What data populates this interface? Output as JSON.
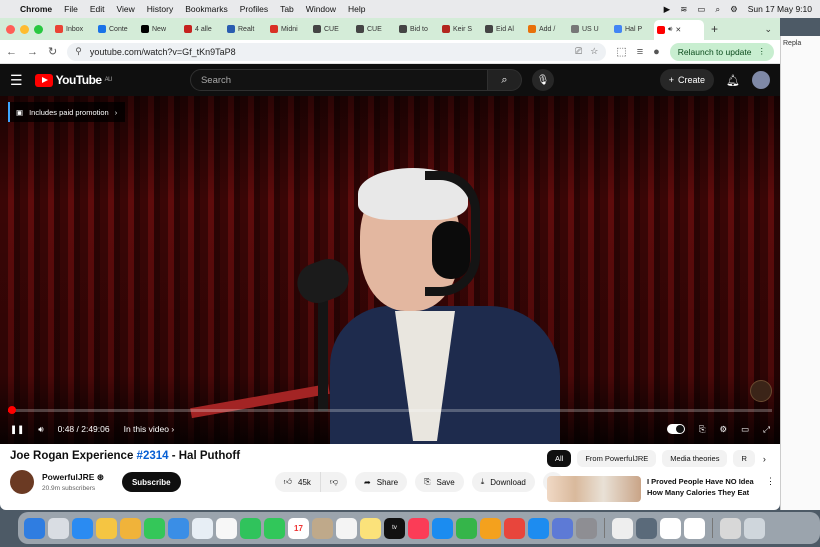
{
  "menubar": {
    "app": "Chrome",
    "items": [
      "File",
      "Edit",
      "View",
      "History",
      "Bookmarks",
      "Profiles",
      "Tab",
      "Window",
      "Help"
    ],
    "clock": "Sun 17 May  9:10"
  },
  "tabs": [
    {
      "label": "Inbox",
      "color": "#ea4335"
    },
    {
      "label": "Conte",
      "color": "#1a73e8"
    },
    {
      "label": "New ",
      "color": "#000000"
    },
    {
      "label": "4 alle",
      "color": "#c5221f"
    },
    {
      "label": "Realt",
      "color": "#2a5db0"
    },
    {
      "label": "Midni",
      "color": "#d93025"
    },
    {
      "label": "CUE",
      "color": "#444444"
    },
    {
      "label": "CUE",
      "color": "#444444"
    },
    {
      "label": "Bid to",
      "color": "#444444"
    },
    {
      "label": "Keir S",
      "color": "#b3261e"
    },
    {
      "label": "Eid Al",
      "color": "#444444"
    },
    {
      "label": "Add /",
      "color": "#e8710a"
    },
    {
      "label": "US U",
      "color": "#777777"
    },
    {
      "label": "Hal P",
      "color": "#4285f4"
    }
  ],
  "active_tab": {
    "label": "",
    "color": "#ff0000"
  },
  "url": "youtube.com/watch?v=Gf_tKn9TaP8",
  "relaunch_label": "Relaunch to update",
  "youtube": {
    "logo_text": "YouTube",
    "region": "AU",
    "search_placeholder": "Search",
    "create_label": "Create"
  },
  "player": {
    "paid_promotion": "Includes paid promotion",
    "time": "0:48 / 2:49:06",
    "in_this_video": "In this video",
    "progress_fraction": 0.0047
  },
  "video": {
    "title_prefix": "Joe Rogan Experience ",
    "title_tag": "#2314",
    "title_suffix": " - Hal Puthoff",
    "channel": "PowerfulJRE",
    "verified": "⊛",
    "subscribers": "20.9m subscribers",
    "subscribe_label": "Subscribe",
    "likes": "45k",
    "share_label": "Share",
    "save_label": "Save",
    "download_label": "Download"
  },
  "chips": [
    "All",
    "From PowerfulJRE",
    "Media theories",
    "R"
  ],
  "recommendation": {
    "title": "I Proved People Have NO Idea How Many Calories They Eat"
  },
  "side_window": {
    "label": "Repla"
  }
}
